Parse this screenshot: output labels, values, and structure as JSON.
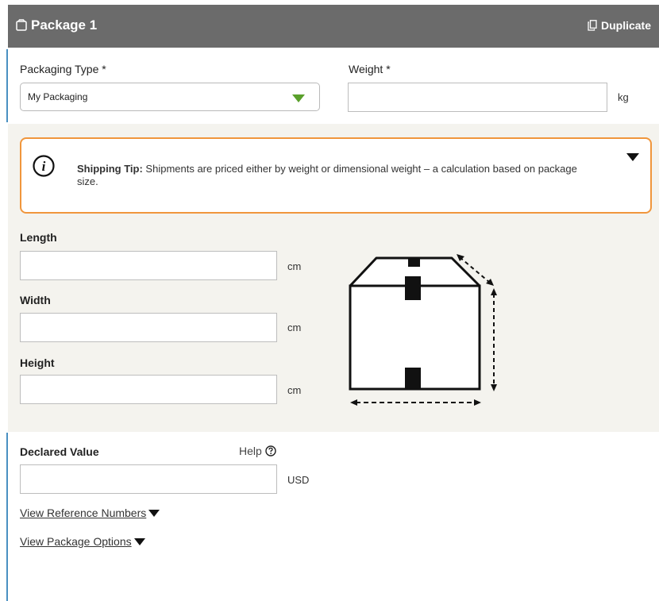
{
  "header": {
    "title": "Package 1",
    "duplicate_label": "Duplicate",
    "icon": "package-icon",
    "duplicate_icon": "copy-icon"
  },
  "packaging": {
    "label": "Packaging Type *",
    "selected": "My Packaging",
    "caret_color": "#5aa02c"
  },
  "weight": {
    "label": "Weight *",
    "value": "",
    "unit": "kg"
  },
  "tip": {
    "icon": "info-icon",
    "title": "Shipping Tip:",
    "body": " Shipments are priced either by weight or dimensional weight – a calculation based on package size.",
    "toggle_icon": "triangle-down-icon",
    "border_color": "#f0963c"
  },
  "dimensions": {
    "length": {
      "label": "Length",
      "value": "",
      "unit": "cm"
    },
    "width": {
      "label": "Width",
      "value": "",
      "unit": "cm"
    },
    "height": {
      "label": "Height",
      "value": "",
      "unit": "cm"
    },
    "illustration": "box-dimensions-icon"
  },
  "declared_value": {
    "label": "Declared Value",
    "help_label": "Help",
    "help_icon": "question-circle-icon",
    "value": "",
    "unit": "USD"
  },
  "links": {
    "reference_numbers": "View Reference Numbers",
    "package_options": "View Package Options"
  },
  "colors": {
    "header_bg": "#6b6b6b",
    "panel_bg": "#f4f3ee",
    "accent_blue": "#4a90c2"
  }
}
